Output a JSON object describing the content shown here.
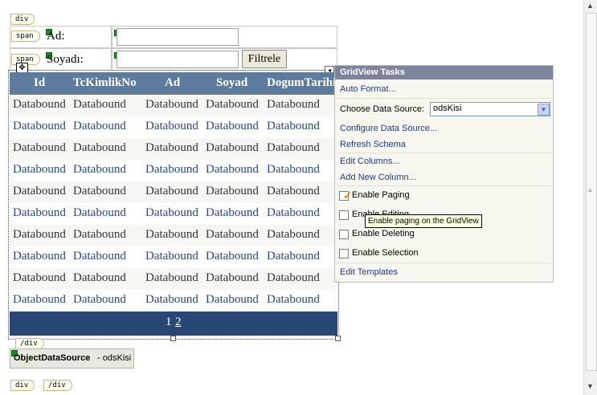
{
  "tags": {
    "div_top": "div",
    "span1": "span",
    "span2": "span",
    "div_close": "/div",
    "bottom_div": "div",
    "bottom_div_close": "/div"
  },
  "form": {
    "ad_label": "Ad:",
    "soyad_label": "Soyadı:",
    "filter_button": "Filtrele"
  },
  "grid": {
    "headers": [
      "Id",
      "TcKimlikNo",
      "Ad",
      "Soyad",
      "DogumTarihi"
    ],
    "rows": [
      [
        "Databound",
        "Databound",
        "Databound",
        "Databound",
        "Databound"
      ],
      [
        "Databound",
        "Databound",
        "Databound",
        "Databound",
        "Databound"
      ],
      [
        "Databound",
        "Databound",
        "Databound",
        "Databound",
        "Databound"
      ],
      [
        "Databound",
        "Databound",
        "Databound",
        "Databound",
        "Databound"
      ],
      [
        "Databound",
        "Databound",
        "Databound",
        "Databound",
        "Databound"
      ],
      [
        "Databound",
        "Databound",
        "Databound",
        "Databound",
        "Databound"
      ],
      [
        "Databound",
        "Databound",
        "Databound",
        "Databound",
        "Databound"
      ],
      [
        "Databound",
        "Databound",
        "Databound",
        "Databound",
        "Databound"
      ],
      [
        "Databound",
        "Databound",
        "Databound",
        "Databound",
        "Databound"
      ],
      [
        "Databound",
        "Databound",
        "Databound",
        "Databound",
        "Databound"
      ]
    ],
    "pager": [
      "1",
      "2"
    ],
    "colors": {
      "header": "#5d7b9d",
      "pager": "#284775",
      "row_odd": "#f7f6f3",
      "row_even": "#ffffff",
      "text_odd": "#333333",
      "text_even": "#284775"
    }
  },
  "object_data_source": {
    "name": "ObjectDataSource",
    "id": " - odsKisi"
  },
  "tasks": {
    "title": "GridView Tasks",
    "auto_format": "Auto Format...",
    "choose_source_label": "Choose Data Source:",
    "choose_source_value": "odsKisi",
    "configure_source": "Configure Data Source...",
    "refresh_schema": "Refresh Schema",
    "edit_columns": "Edit Columns...",
    "add_column": "Add New Column...",
    "enable_paging": "Enable Paging",
    "enable_editing": "Enable Editing",
    "enable_deleting": "Enable Deleting",
    "enable_selection": "Enable Selection",
    "edit_templates": "Edit Templates",
    "paging_checked": true
  },
  "tooltip": "Enable paging on the GridView",
  "icons": [
    "move-handle-icon",
    "smart-tag-arrow-icon",
    "dropdown-arrow-icon",
    "checkmark-icon",
    "scroll-up-icon",
    "scroll-down-icon",
    "scroll-grip-icon"
  ]
}
